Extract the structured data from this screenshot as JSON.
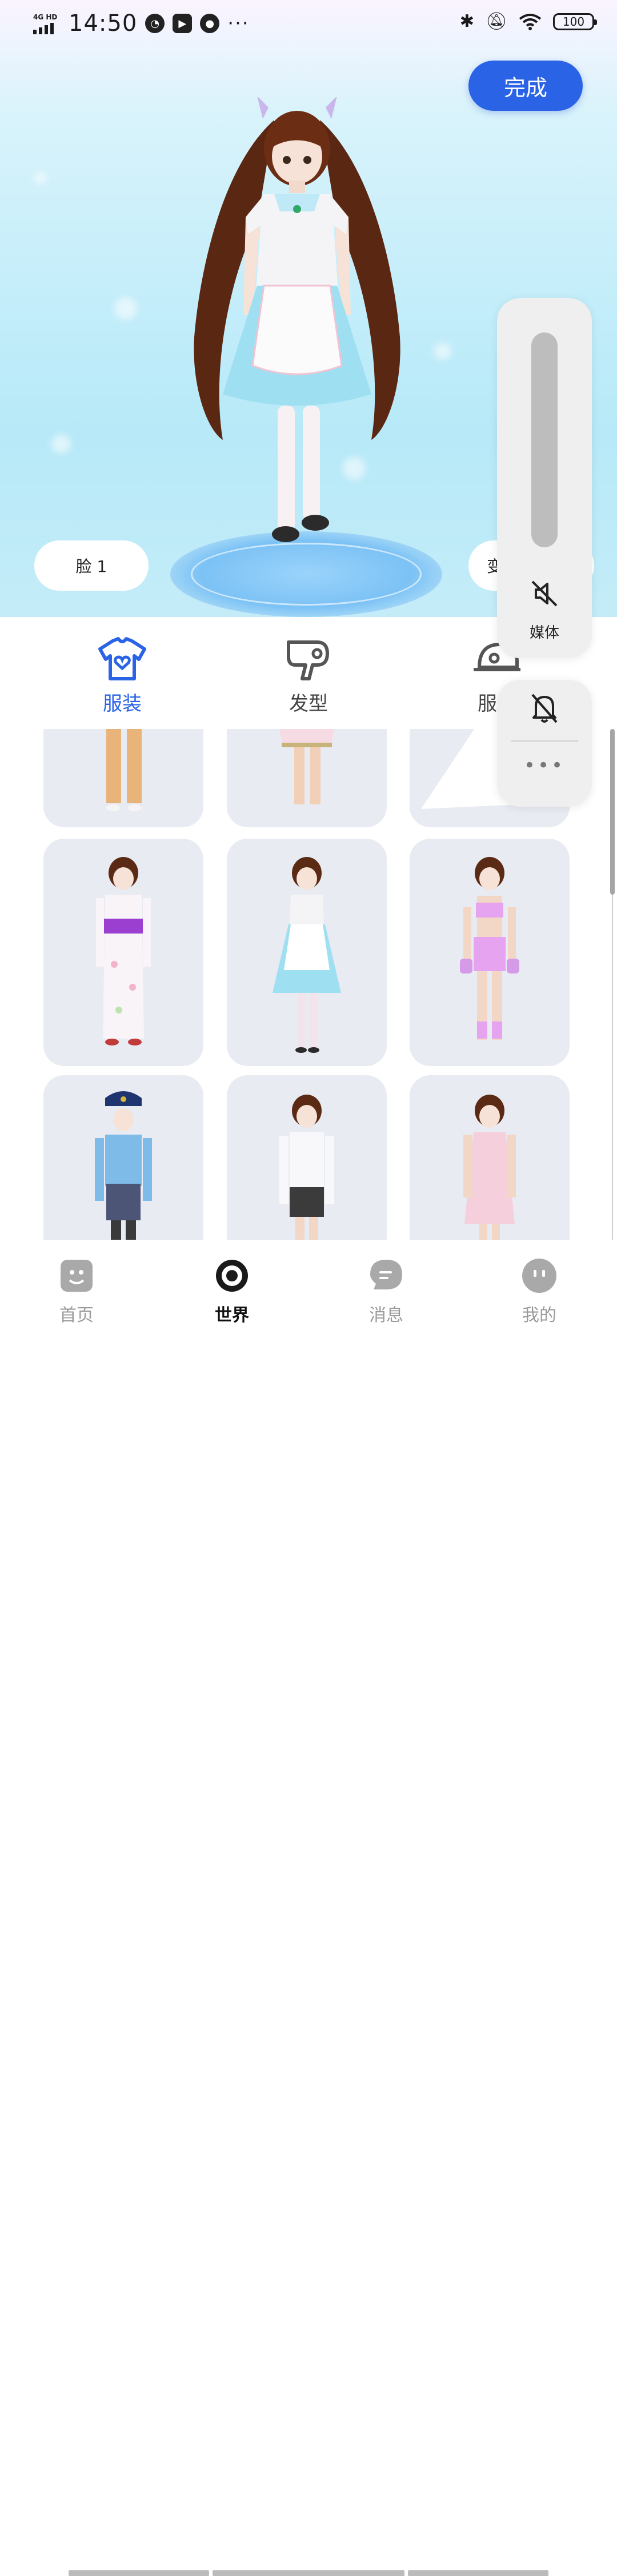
{
  "status_bar": {
    "network": "4G HD",
    "time": "14:50",
    "more": "···",
    "battery": "100"
  },
  "header": {
    "done_label": "完成"
  },
  "scene": {
    "face_button": "脸 1",
    "change_button": "变"
  },
  "categories": [
    {
      "label": "服装",
      "icon": "tshirt-heart-icon",
      "active": true
    },
    {
      "label": "发型",
      "icon": "hair-dryer-icon",
      "active": false
    },
    {
      "label": "服饰",
      "icon": "cap-icon",
      "active": false
    }
  ],
  "volume_panel": {
    "media_label": "媒体",
    "more": "•••"
  },
  "outfits": [
    {
      "name": "orange-pants"
    },
    {
      "name": "pink-skirt"
    },
    {
      "name": "white-gown"
    },
    {
      "name": "kimono"
    },
    {
      "name": "maid-dress"
    },
    {
      "name": "pink-sportswear"
    },
    {
      "name": "police-uniform"
    },
    {
      "name": "office-suit"
    },
    {
      "name": "pink-dress"
    }
  ],
  "bottom_nav": [
    {
      "label": "首页",
      "icon": "home-face-icon",
      "active": false
    },
    {
      "label": "世界",
      "icon": "world-ring-icon",
      "active": true
    },
    {
      "label": "消息",
      "icon": "message-bubble-icon",
      "active": false
    },
    {
      "label": "我的",
      "icon": "profile-face-icon",
      "active": false
    }
  ],
  "colors": {
    "accent": "#2a63e6",
    "card_bg": "#e8ebf2",
    "sky": "#c6eefa"
  }
}
